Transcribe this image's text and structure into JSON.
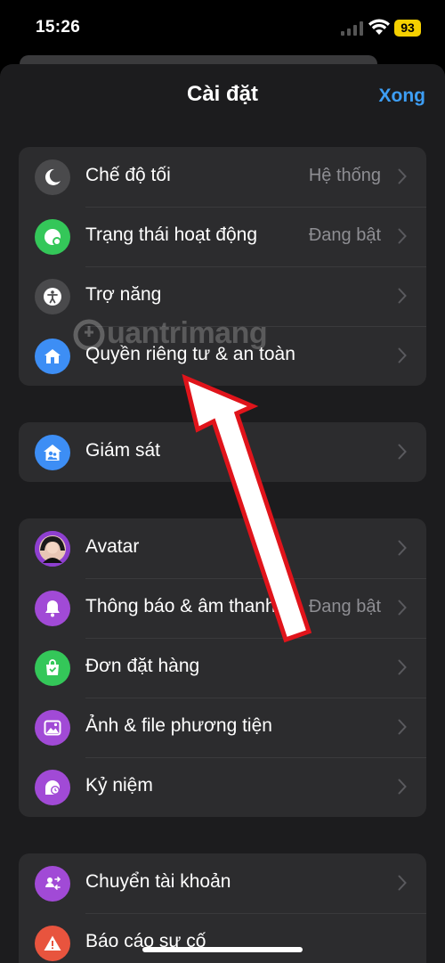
{
  "status": {
    "time": "15:26",
    "battery": "93"
  },
  "header": {
    "title": "Cài đặt",
    "done": "Xong"
  },
  "group1": [
    {
      "label": "Chế độ tối",
      "value": "Hệ thống",
      "icon": "moon-icon"
    },
    {
      "label": "Trạng thái hoạt động",
      "value": "Đang bật",
      "icon": "active-status-icon"
    },
    {
      "label": "Trợ năng",
      "value": "",
      "icon": "accessibility-icon"
    },
    {
      "label": "Quyền riêng tư & an toàn",
      "value": "",
      "icon": "privacy-home-icon"
    }
  ],
  "group2": [
    {
      "label": "Giám sát",
      "value": "",
      "icon": "supervision-icon"
    }
  ],
  "group3": [
    {
      "label": "Avatar",
      "value": "",
      "icon": "avatar-icon"
    },
    {
      "label": "Thông báo & âm thanh",
      "value": "Đang bật",
      "icon": "bell-icon"
    },
    {
      "label": "Đơn đặt hàng",
      "value": "",
      "icon": "shopping-bag-icon"
    },
    {
      "label": "Ảnh & file phương tiện",
      "value": "",
      "icon": "photo-icon"
    },
    {
      "label": "Kỷ niệm",
      "value": "",
      "icon": "memories-icon"
    }
  ],
  "group4": [
    {
      "label": "Chuyển tài khoản",
      "value": "",
      "icon": "switch-account-icon"
    },
    {
      "label": "Báo cáo sự cố",
      "value": "",
      "icon": "warning-icon"
    }
  ],
  "watermark": "uantrimang",
  "colors": {
    "accent": "#3d9ef5",
    "sheet": "#1c1c1e",
    "group": "#2c2c2e",
    "arrow": "#e0141b"
  }
}
